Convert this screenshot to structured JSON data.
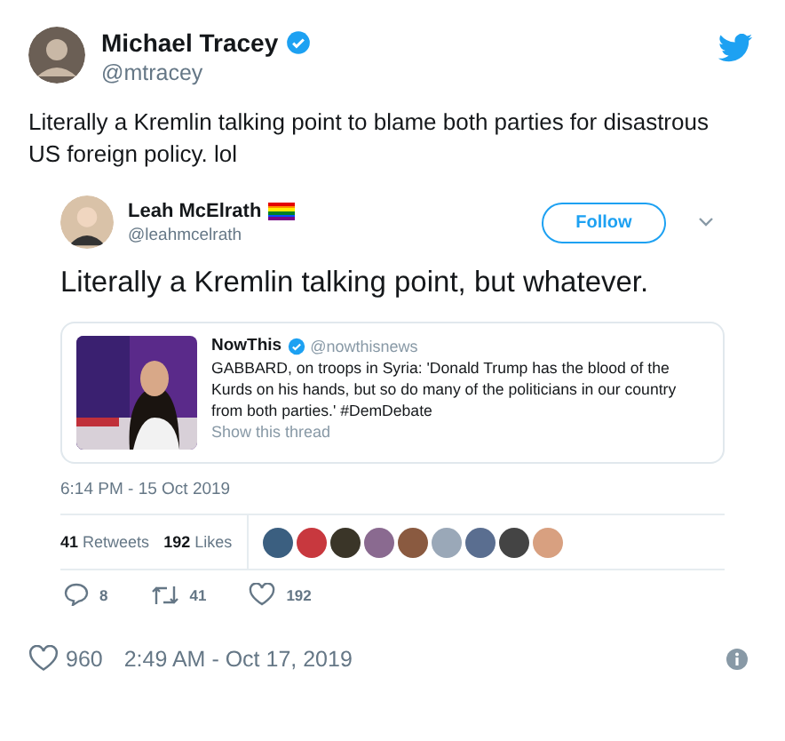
{
  "tweet": {
    "author": {
      "name": "Michael Tracey",
      "handle": "@mtracey",
      "verified": true
    },
    "text": "Literally a Kremlin talking point to blame both parties for disastrous US foreign policy. lol",
    "embedded": {
      "author": {
        "name": "Leah McElrath",
        "handle": "@leahmcelrath",
        "flag": true
      },
      "follow_label": "Follow",
      "text": "Literally a Kremlin talking point, but whatever.",
      "quoted": {
        "name": "NowThis",
        "verified": true,
        "handle": "@nowthisnews",
        "text": "GABBARD, on troops in Syria: 'Donald Trump has the blood of the Kurds on his hands, but so do many of the politicians in our country from both parties.' #DemDebate",
        "link": "Show this thread"
      },
      "timestamp": "6:14 PM - 15 Oct 2019",
      "stats": {
        "retweets_count": "41",
        "retweets_label": "Retweets",
        "likes_count": "192",
        "likes_label": "Likes"
      },
      "liker_avatars": [
        {
          "color": "#3b5f80"
        },
        {
          "color": "#c8383e"
        },
        {
          "color": "#3a3528"
        },
        {
          "color": "#8a6a90"
        },
        {
          "color": "#8a5a40"
        },
        {
          "color": "#9aa8b8"
        },
        {
          "color": "#5a6e90"
        },
        {
          "color": "#444444"
        },
        {
          "color": "#d8a080"
        }
      ],
      "actions": {
        "replies": "8",
        "retweets": "41",
        "likes": "192"
      }
    },
    "footer": {
      "likes": "960",
      "timestamp": "2:49 AM - Oct 17, 2019"
    }
  }
}
